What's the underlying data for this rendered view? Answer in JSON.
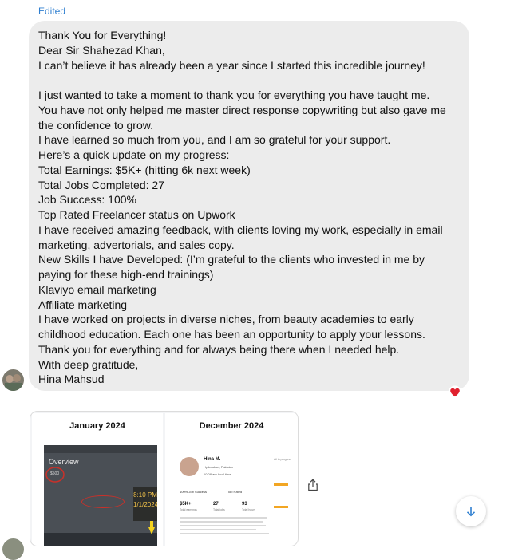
{
  "message": {
    "status_label": "Edited",
    "lines": [
      "Thank You for Everything!",
      "Dear Sir Shahezad Khan,",
      "I can’t believe it has already been a year since I started this incredible journey!",
      "",
      "I just wanted to take a moment to thank you for everything you have taught me.",
      "You have not only helped me master direct response copywriting but also gave me",
      "the confidence to grow.",
      "I have learned so much from you, and I am so grateful for your support.",
      "Here’s a quick update on my progress:",
      "Total Earnings: $5K+ (hitting 6k next week)",
      "Total Jobs Completed: 27",
      "Job Success: 100%",
      "Top Rated Freelancer status on Upwork",
      "I have received amazing feedback, with clients loving my work, especially in email",
      "marketing, advertorials, and sales copy.",
      "New Skills I have Developed: (I’m grateful to the clients who invested in me by",
      "paying for these high-end trainings)",
      "Klaviyo email marketing",
      "Affiliate marketing",
      "I have worked on projects in diverse niches, from beauty academies to early",
      "childhood education. Each one has been an opportunity to apply your lessons.",
      "Thank you for everything and for always being there when I needed help.",
      "With deep gratitude,",
      "Hina Mahsud"
    ],
    "reaction_icon": "red-heart",
    "bubble_color": "#ececec",
    "status_color": "#2f7fd0"
  },
  "attachment": {
    "left": {
      "title": "January 2024",
      "photo_heading": "Overview",
      "photo_amount": "$500",
      "photo_time": "8:10 PM",
      "photo_date": "1/1/2024"
    },
    "right": {
      "title": "December 2024",
      "name": "Hina M.",
      "location": "Hyderabad, Pakistan",
      "local_time": "10:08 am local time",
      "badge_success": "100% Job Success",
      "badge_rated": "Top Rated",
      "stats": [
        {
          "value": "$5K+",
          "label": "Total earnings"
        },
        {
          "value": "27",
          "label": "Total jobs"
        },
        {
          "value": "93",
          "label": "Total hours"
        }
      ],
      "progress_label": "All in progress"
    }
  },
  "actions": {
    "share_icon": "share-icon",
    "scroll_down_icon": "arrow-down-icon"
  }
}
